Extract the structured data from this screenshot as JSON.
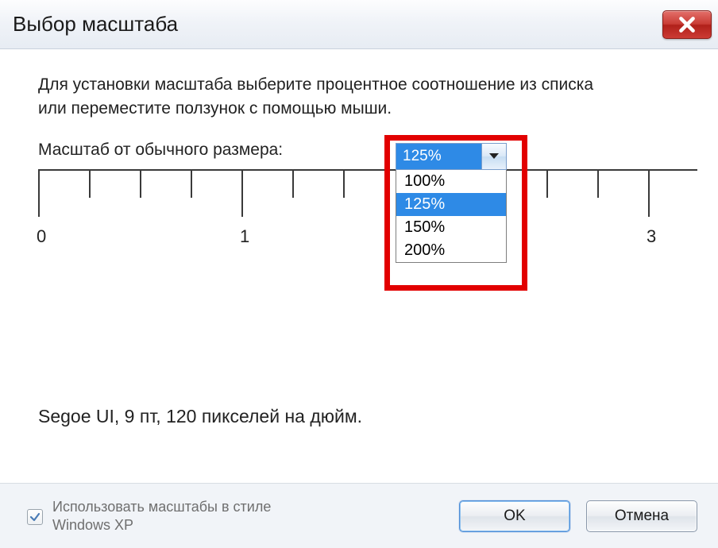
{
  "window": {
    "title": "Выбор масштаба"
  },
  "instructions": "Для установки масштаба выберите процентное соотношение из списка или переместите ползунок с помощью мыши.",
  "scale": {
    "label": "Масштаб от обычного размера:",
    "selected": "125%",
    "options": [
      "100%",
      "125%",
      "150%",
      "200%"
    ]
  },
  "ruler": {
    "labels": [
      "0",
      "1",
      "3"
    ]
  },
  "font_info": "Segoe UI, 9 пт, 120 пикселей на дюйм.",
  "footer": {
    "xp_checkbox_label": "Использовать масштабы в стиле Windows XP",
    "ok": "OK",
    "cancel": "Отмена"
  },
  "highlight_color": "#e20000"
}
